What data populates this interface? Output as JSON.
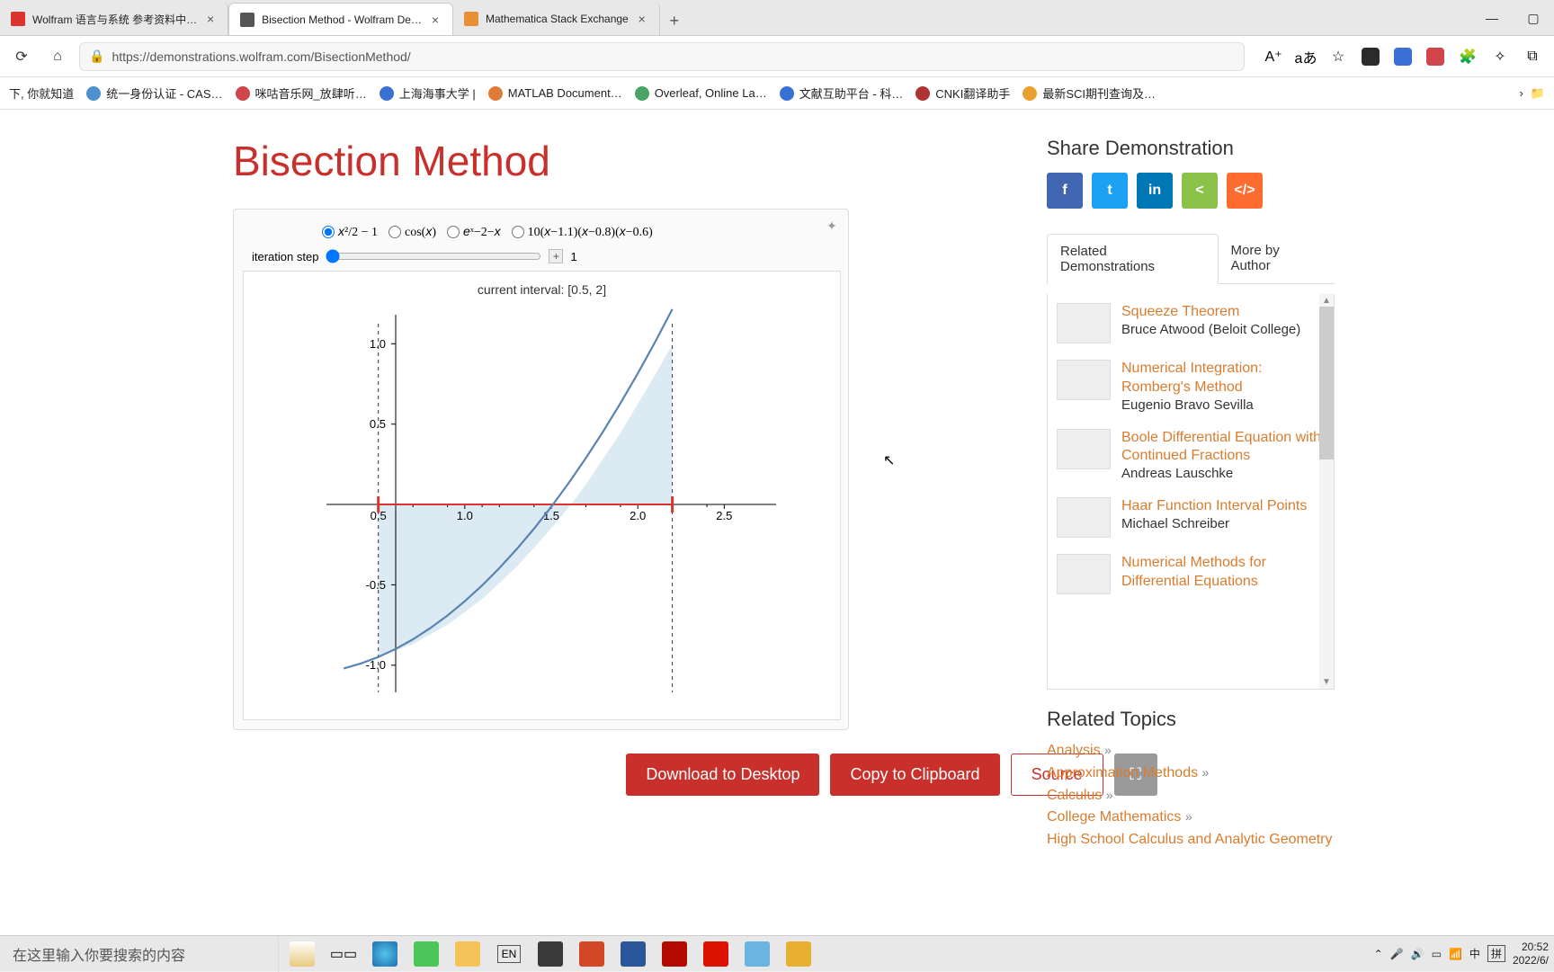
{
  "browser": {
    "tabs": [
      {
        "title": "Wolfram 语言与系统 参考资料中…",
        "active": false,
        "favicon": "#d9342f"
      },
      {
        "title": "Bisection Method - Wolfram De…",
        "active": true,
        "favicon": "#555"
      },
      {
        "title": "Mathematica Stack Exchange",
        "active": false,
        "favicon": "#e88e35"
      }
    ],
    "url": "https://demonstrations.wolfram.com/BisectionMethod/",
    "bookmarks": [
      {
        "label": "下, 你就知道",
        "color": "#ddd"
      },
      {
        "label": "统一身份认证 - CAS…",
        "color": "#4d8fcf"
      },
      {
        "label": "咪咕音乐网_放肆听…",
        "color": "#d0464b"
      },
      {
        "label": "上海海事大学 |",
        "color": "#3a70d4"
      },
      {
        "label": "MATLAB Document…",
        "color": "#e07b3a"
      },
      {
        "label": "Overleaf, Online La…",
        "color": "#4aa564"
      },
      {
        "label": "文献互助平台 - 科…",
        "color": "#3a70d4"
      },
      {
        "label": "CNKI翻译助手",
        "color": "#b03333"
      },
      {
        "label": "最新SCI期刊查询及…",
        "color": "#e8a030"
      }
    ]
  },
  "page": {
    "title": "Bisection Method",
    "functions": {
      "opt1": "x²/2 − 1",
      "opt2": "cos(x)",
      "opt3": "eˣ − 2 − x",
      "opt4": "10(x−1.1)(x−0.8)(x−0.6)"
    },
    "slider": {
      "label": "iteration step",
      "value": "1"
    },
    "plot": {
      "caption": "current interval: [0.5, 2]",
      "y_ticks": [
        "1.0",
        "0.5",
        "-0.5",
        "-1.0"
      ],
      "x_ticks": [
        "0.5",
        "1.0",
        "1.5",
        "2.0",
        "2.5"
      ]
    },
    "actions": {
      "download": "Download to Desktop",
      "copy": "Copy to Clipboard",
      "source": "Source"
    }
  },
  "sidebar": {
    "share_title": "Share Demonstration",
    "share": [
      {
        "glyph": "f",
        "color": "#4267b2"
      },
      {
        "glyph": "t",
        "color": "#1da1f2"
      },
      {
        "glyph": "in",
        "color": "#0077b5"
      },
      {
        "glyph": "<",
        "color": "#8bc34a"
      },
      {
        "glyph": "</>",
        "color": "#ff6c2f"
      }
    ],
    "tabs": {
      "related": "Related Demonstrations",
      "more": "More by Author"
    },
    "items": [
      {
        "title": "Squeeze Theorem",
        "author": "Bruce Atwood (Beloit College)"
      },
      {
        "title": "Numerical Integration: Romberg's Method",
        "author": "Eugenio Bravo Sevilla"
      },
      {
        "title": "Boole Differential Equation with Continued Fractions",
        "author": "Andreas Lauschke"
      },
      {
        "title": "Haar Function Interval Points",
        "author": "Michael Schreiber"
      },
      {
        "title": "Numerical Methods for Differential Equations",
        "author": ""
      }
    ],
    "topics_title": "Related Topics",
    "topics": [
      "Analysis",
      "Approximation Methods",
      "Calculus",
      "College Mathematics",
      "High School Calculus and Analytic Geometry"
    ]
  },
  "taskbar": {
    "search_placeholder": "在这里输入你要搜索的内容",
    "lang": "EN",
    "ime1": "中",
    "ime2": "拼",
    "time": "20:52",
    "date": "2022/6/"
  },
  "chart_data": {
    "type": "line",
    "title": "current interval: [0.5, 2]",
    "xlabel": "",
    "ylabel": "",
    "xlim": [
      0.2,
      2.8
    ],
    "ylim": [
      -1.25,
      1.1
    ],
    "x_ticks": [
      0.5,
      1.0,
      1.5,
      2.0,
      2.5
    ],
    "y_ticks": [
      -1.0,
      -0.5,
      0.5,
      1.0
    ],
    "series": [
      {
        "name": "x^2/2 - 1",
        "x": [
          0.3,
          0.5,
          0.7,
          0.9,
          1.1,
          1.3,
          1.4142,
          1.5,
          1.7,
          1.9,
          2.0
        ],
        "values": [
          -0.955,
          -0.875,
          -0.755,
          -0.595,
          -0.395,
          -0.155,
          0.0,
          0.125,
          0.445,
          0.805,
          1.0
        ]
      }
    ],
    "interval_markers": [
      0.5,
      2.0
    ],
    "shaded_region": {
      "x": [
        0.5,
        2.0
      ],
      "from": "curve",
      "to": 0
    }
  }
}
